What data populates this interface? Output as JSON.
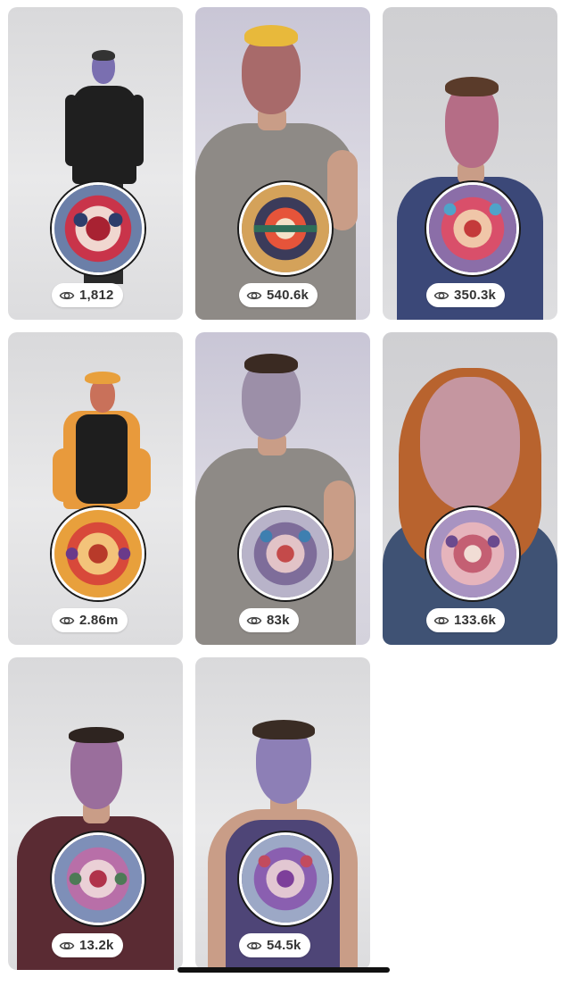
{
  "cards": [
    {
      "views": "1,812",
      "eye_icon": "eye-icon"
    },
    {
      "views": "540.6k",
      "eye_icon": "eye-icon"
    },
    {
      "views": "350.3k",
      "eye_icon": "eye-icon"
    },
    {
      "views": "2.86m",
      "eye_icon": "eye-icon"
    },
    {
      "views": "83k",
      "eye_icon": "eye-icon"
    },
    {
      "views": "133.6k",
      "eye_icon": "eye-icon"
    },
    {
      "views": "13.2k",
      "eye_icon": "eye-icon"
    },
    {
      "views": "54.5k",
      "eye_icon": "eye-icon"
    }
  ],
  "colors": {
    "pill_bg": "#ffffff",
    "pill_text": "#333333",
    "home_indicator": "#111111"
  }
}
